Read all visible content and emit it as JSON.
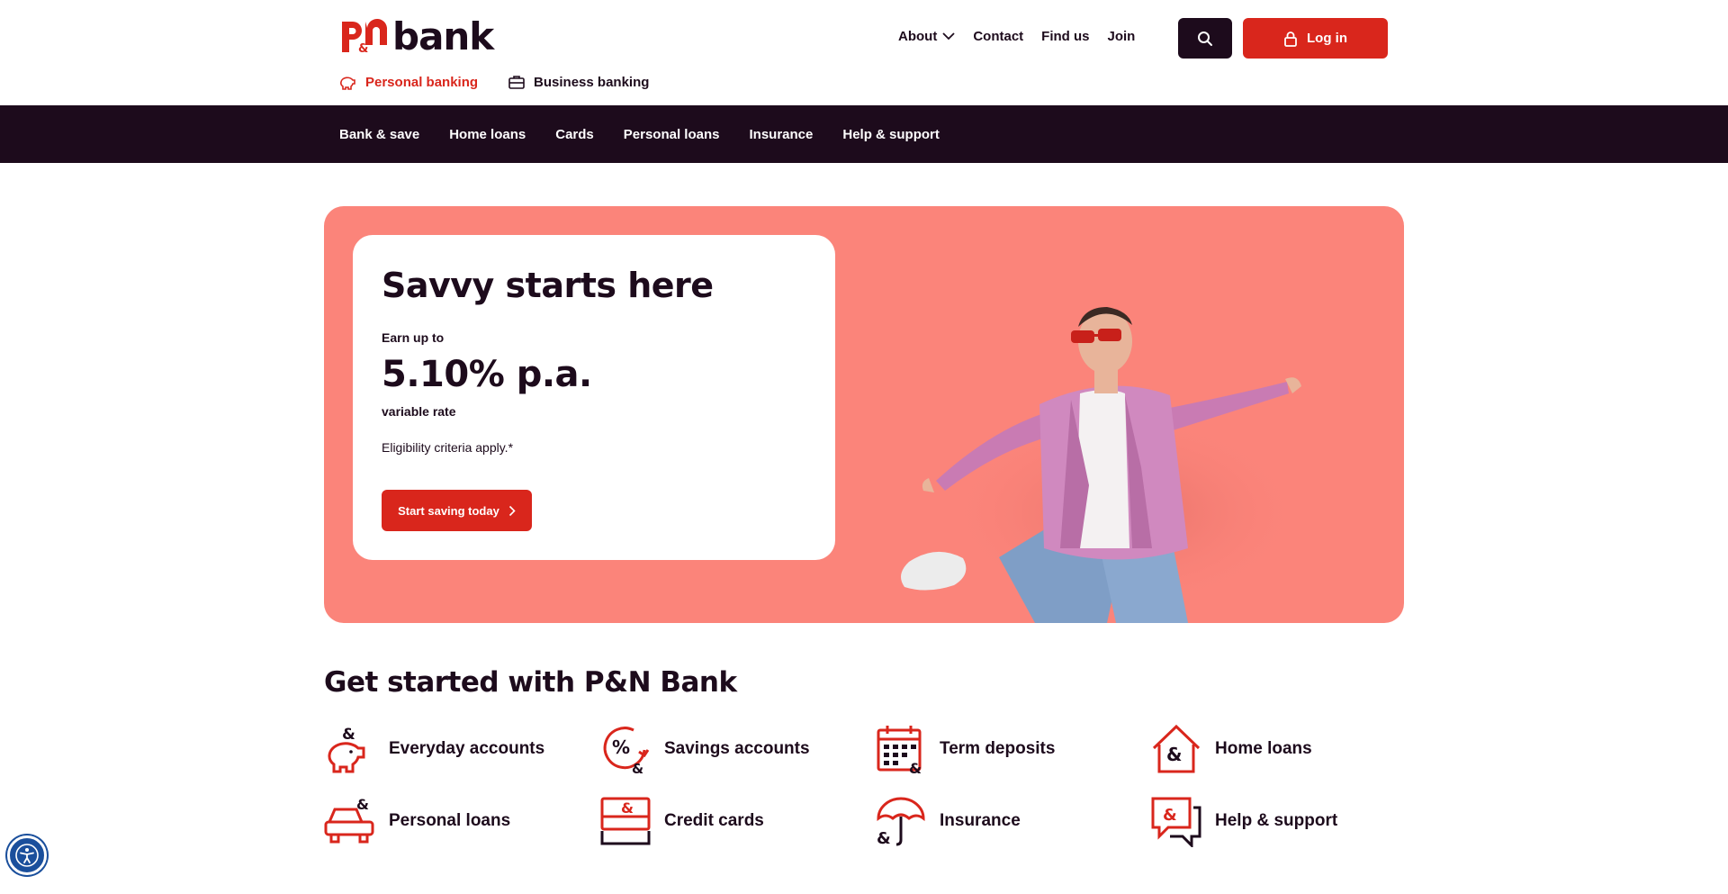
{
  "brand": {
    "logo_mark": "p&n",
    "logo_word": "bank"
  },
  "topnav": {
    "about": "About",
    "contact": "Contact",
    "find_us": "Find us",
    "join": "Join"
  },
  "header": {
    "login_label": "Log in"
  },
  "segments": {
    "personal": "Personal banking",
    "business": "Business banking"
  },
  "mainnav": [
    "Bank & save",
    "Home loans",
    "Cards",
    "Personal loans",
    "Insurance",
    "Help & support"
  ],
  "hero": {
    "title": "Savvy starts here",
    "earn": "Earn up to",
    "rate": "5.10% p.a.",
    "variable": "variable rate",
    "eligibility": "Eligibility criteria apply.*",
    "cta": "Start saving today"
  },
  "get_started": {
    "title": "Get started with P&N Bank",
    "items": [
      {
        "label": "Everyday accounts",
        "icon": "piggy-bank-icon"
      },
      {
        "label": "Savings accounts",
        "icon": "percent-icon"
      },
      {
        "label": "Term deposits",
        "icon": "calendar-icon"
      },
      {
        "label": "Home loans",
        "icon": "house-icon"
      },
      {
        "label": "Personal loans",
        "icon": "car-icon"
      },
      {
        "label": "Credit cards",
        "icon": "card-icon"
      },
      {
        "label": "Insurance",
        "icon": "umbrella-icon"
      },
      {
        "label": "Help & support",
        "icon": "chat-icon"
      }
    ]
  },
  "colors": {
    "brand_red": "#d9261c",
    "dark": "#1d0b1c",
    "hero_bg": "#fb847a"
  }
}
